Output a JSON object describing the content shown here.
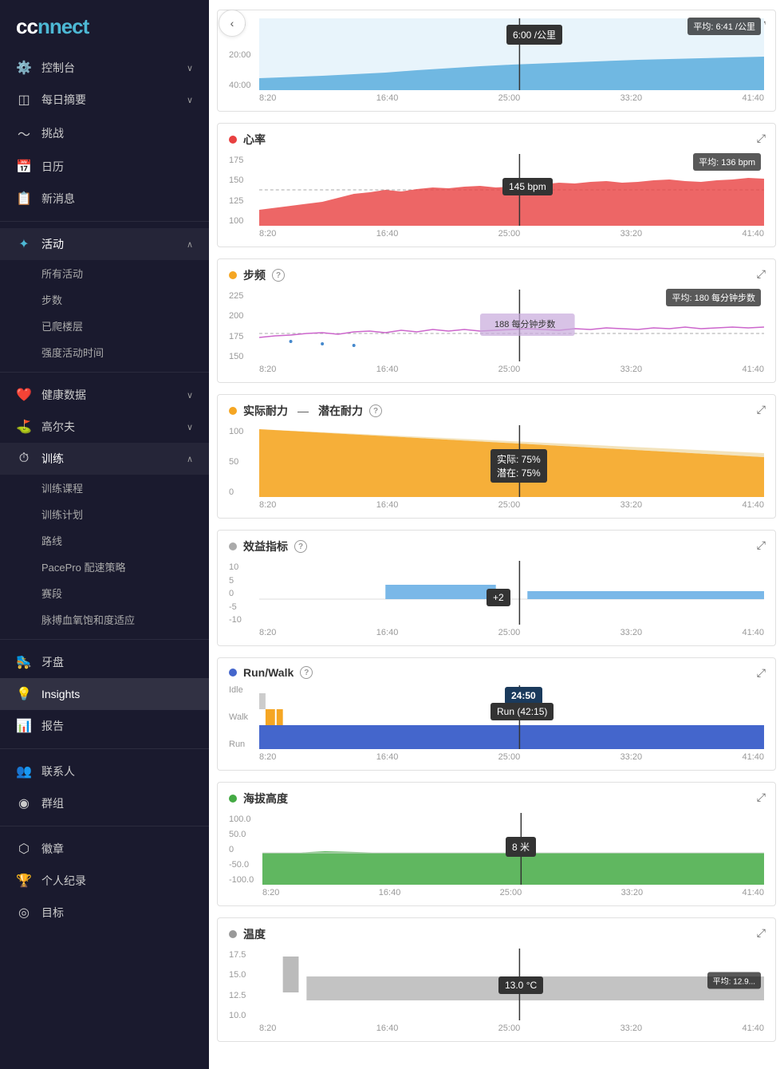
{
  "logo": {
    "text": "connect"
  },
  "sidebar": {
    "sections": [
      {
        "items": [
          {
            "id": "dashboard",
            "icon": "⚙",
            "label": "控制台",
            "hasChevron": true,
            "expanded": false
          },
          {
            "id": "daily",
            "icon": "◫",
            "label": "每日摘要",
            "hasChevron": true,
            "expanded": false
          },
          {
            "id": "challenges",
            "icon": "∿",
            "label": "挑战",
            "hasChevron": false
          },
          {
            "id": "calendar",
            "icon": "▦",
            "label": "日历",
            "hasChevron": false
          },
          {
            "id": "messages",
            "icon": "▭",
            "label": "新消息",
            "hasChevron": false
          }
        ]
      },
      {
        "items": [
          {
            "id": "activities",
            "icon": "✦",
            "label": "活动",
            "hasChevron": true,
            "expanded": true,
            "subItems": [
              "所有活动",
              "步数",
              "已爬楼层",
              "强度活动时间"
            ]
          }
        ]
      },
      {
        "items": [
          {
            "id": "health",
            "icon": "♥",
            "label": "健康数据",
            "hasChevron": true,
            "expanded": false
          },
          {
            "id": "golf",
            "icon": "⛳",
            "label": "高尔夫",
            "hasChevron": true,
            "expanded": false
          },
          {
            "id": "training",
            "icon": "⏱",
            "label": "训练",
            "hasChevron": true,
            "expanded": true,
            "subItems": [
              "训练课程",
              "训练计划",
              "路线",
              "PacePro 配速策略",
              "赛段",
              "脉搏血氧饱和度适应"
            ]
          }
        ]
      },
      {
        "items": [
          {
            "id": "cycling",
            "icon": "⛸",
            "label": "牙盘",
            "hasChevron": false
          },
          {
            "id": "insights",
            "icon": "💡",
            "label": "Insights",
            "hasChevron": false,
            "active": true
          },
          {
            "id": "reports",
            "icon": "📊",
            "label": "报告",
            "hasChevron": false
          }
        ]
      },
      {
        "items": [
          {
            "id": "contacts",
            "icon": "👥",
            "label": "联系人",
            "hasChevron": false
          },
          {
            "id": "groups",
            "icon": "◉",
            "label": "群组",
            "hasChevron": false
          }
        ]
      },
      {
        "items": [
          {
            "id": "badges",
            "icon": "⬡",
            "label": "徽章",
            "hasChevron": false
          },
          {
            "id": "records",
            "icon": "🏆",
            "label": "个人纪录",
            "hasChevron": false
          },
          {
            "id": "goals",
            "icon": "◎",
            "label": "目标",
            "hasChevron": false
          }
        ]
      }
    ]
  },
  "charts": {
    "pace": {
      "title": "",
      "yLabels": [
        "0:00",
        "20:00",
        "40:00"
      ],
      "xLabels": [
        "8:20",
        "16:40",
        "25:00",
        "33:20",
        "41:40"
      ],
      "tooltip": "6:00 /公里",
      "avg": "平均: 6:41 /公里",
      "color": "#5aaddd"
    },
    "heartrate": {
      "title": "心率",
      "dotColor": "#e84040",
      "yLabels": [
        "175",
        "150",
        "125",
        "100"
      ],
      "xLabels": [
        "8:20",
        "16:40",
        "25:00",
        "33:20",
        "41:40"
      ],
      "tooltip": "145 bpm",
      "avg": "平均: 136 bpm",
      "color": "#e84040"
    },
    "cadence": {
      "title": "步频",
      "dotColor": "#f5a623",
      "hasQuestion": true,
      "yLabels": [
        "225",
        "200",
        "175",
        "150"
      ],
      "xLabels": [
        "8:20",
        "16:40",
        "25:00",
        "33:20",
        "41:40"
      ],
      "tooltip": "188 每分钟步数",
      "avg": "平均: 180 每分钟步数",
      "color": "#cc66cc"
    },
    "stamina": {
      "title": "实际耐力",
      "title2": "潜在耐力",
      "dotColor": "#f5a623",
      "hasQuestion": true,
      "yLabels": [
        "100",
        "50",
        "0"
      ],
      "xLabels": [
        "8:20",
        "16:40",
        "25:00",
        "33:20",
        "41:40"
      ],
      "tooltip1": "实际: 75%",
      "tooltip2": "潜在: 75%",
      "color": "#f5a623"
    },
    "performance": {
      "title": "效益指标",
      "dotColor": "#aaa",
      "hasQuestion": true,
      "yLabels": [
        "10",
        "5",
        "0",
        "-5",
        "-10"
      ],
      "xLabels": [
        "8:20",
        "16:40",
        "25:00",
        "33:20",
        "41:40"
      ],
      "tooltip": "+2",
      "color": "#7ab8e8"
    },
    "runwalk": {
      "title": "Run/Walk",
      "dotColor": "#4466cc",
      "hasQuestion": true,
      "yLabels": [
        "Idle",
        "Walk",
        "Run"
      ],
      "xLabels": [
        "8:20",
        "16:40",
        "25:00",
        "33:20",
        "41:40"
      ],
      "tooltip1": "24:50",
      "tooltip2": "Run (42:15)",
      "color": "#4466cc"
    },
    "elevation": {
      "title": "海拔高度",
      "dotColor": "#44aa44",
      "yLabels": [
        "100.0",
        "50.0",
        "0",
        "-50.0",
        "-100.0"
      ],
      "xLabels": [
        "8:20",
        "16:40",
        "25:00",
        "33:20",
        "41:40"
      ],
      "tooltip": "8 米",
      "color": "#44aa44"
    },
    "temperature": {
      "title": "温度",
      "dotColor": "#999",
      "yLabels": [
        "17.5",
        "15.0",
        "12.5",
        "10.0"
      ],
      "xLabels": [
        "8:20",
        "16:40",
        "25:00",
        "33:20",
        "41:40"
      ],
      "tooltip": "13.0 °C",
      "avg": "平均: 12.9...",
      "color": "#aaaaaa"
    }
  },
  "back_button": "‹"
}
